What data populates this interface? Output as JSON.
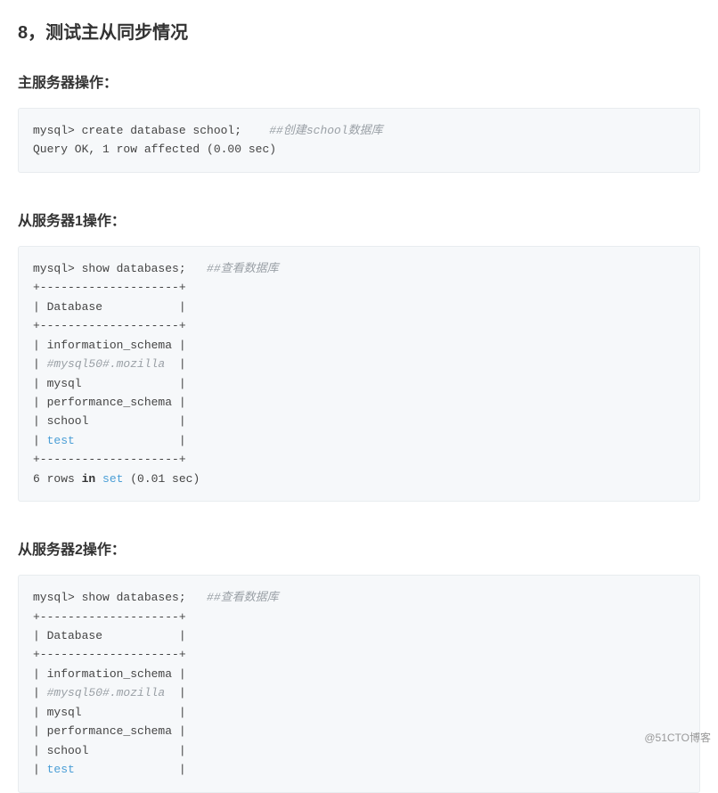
{
  "section": {
    "title": "8，测试主从同步情况"
  },
  "blocks": [
    {
      "heading": "主服务器操作：",
      "code": {
        "line1_prefix": "mysql> create database school;    ",
        "line1_comment": "##创建school数据库",
        "line2": "Query OK, 1 row affected (0.00 sec)"
      }
    },
    {
      "heading": "从服务器1操作：",
      "code": {
        "line_cmd_prefix": "mysql> show databases;   ",
        "line_cmd_comment": "##查看数据库",
        "sep": "+--------------------+",
        "hdr": "| Database           |",
        "r1": "| information_schema |",
        "r2a": "| ",
        "r2b": "#mysql50#.mozilla",
        "r2c": "  |",
        "r3": "| mysql              |",
        "r4": "| performance_schema |",
        "r5": "| school             |",
        "r6a": "| ",
        "r6b": "test",
        "r6c": "               |",
        "foot": "6 rows ",
        "foot_in": "in",
        "foot_sp": " ",
        "foot_set": "set",
        "foot_end": " (0.01 sec)"
      }
    },
    {
      "heading": "从服务器2操作：",
      "code": {
        "line_cmd_prefix": "mysql> show databases;   ",
        "line_cmd_comment": "##查看数据库",
        "sep": "+--------------------+",
        "hdr": "| Database           |",
        "r1": "| information_schema |",
        "r2a": "| ",
        "r2b": "#mysql50#.mozilla",
        "r2c": "  |",
        "r3": "| mysql              |",
        "r4": "| performance_schema |",
        "r5": "| school             |",
        "r6a": "| ",
        "r6b": "test",
        "r6c": "               |"
      }
    }
  ],
  "watermark": "@51CTO博客"
}
